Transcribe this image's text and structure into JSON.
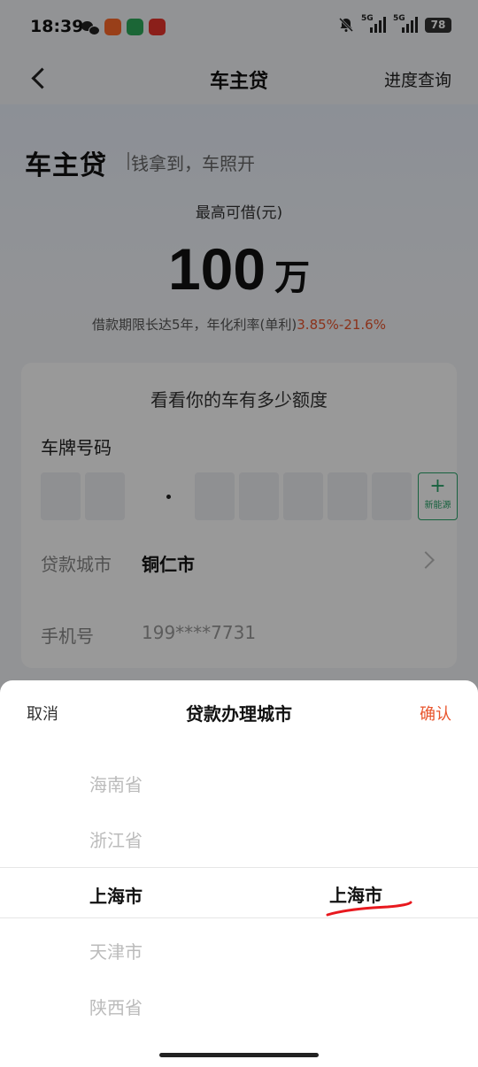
{
  "status_bar": {
    "time": "18:39",
    "network_1": "5G",
    "network_2": "5G",
    "battery": "78",
    "app_icons": [
      "wechat-icon",
      "app-orange-icon",
      "app-green-icon",
      "app-red-icon"
    ],
    "app_colors": [
      "#ff6a2a",
      "#2eaa5a",
      "#e8342c"
    ]
  },
  "header": {
    "title": "车主贷",
    "progress_link": "进度查询"
  },
  "hero": {
    "brand": "车主贷",
    "slogan": "钱拿到，车照开",
    "max_label": "最高可借(元)",
    "amount": "100",
    "amount_unit": "万",
    "terms_prefix": "借款期限长达5年，年化利率(单利)",
    "terms_rate": "3.85%-21.6%"
  },
  "card": {
    "title": "看看你的车有多少额度",
    "plate_label": "车牌号码",
    "new_energy_plus": "+",
    "new_energy_label": "新能源",
    "city_label": "贷款城市",
    "city_value": "铜仁市",
    "phone_label": "手机号",
    "phone_value": "199****7731"
  },
  "sheet": {
    "cancel": "取消",
    "title": "贷款办理城市",
    "confirm": "确认",
    "options": [
      "海南省",
      "浙江省",
      "上海市",
      "天津市",
      "陕西省"
    ],
    "selected_index": 2,
    "right_column_selected": "上海市",
    "accent_color": "#e8542c"
  }
}
